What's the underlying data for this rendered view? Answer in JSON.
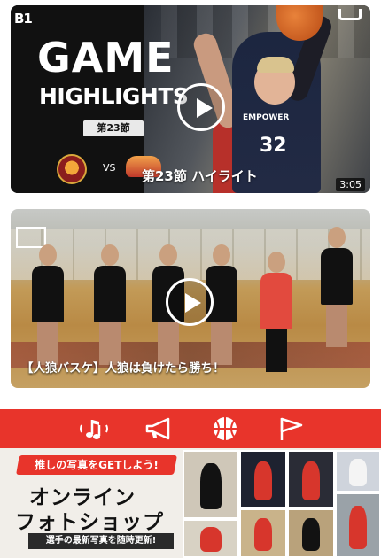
{
  "colors": {
    "brand_red": "#e8342b",
    "card_dark": "#111111",
    "banner_bg": "#f1eee9"
  },
  "video1": {
    "brand": "B1",
    "title_line1": "GAME",
    "title_line2": "HIGHLIGHTS",
    "section_badge": "第23節",
    "vs_label": "VS",
    "jersey_name": "EMPOWER",
    "jersey_number": "32",
    "caption": "第23節 ハイライト",
    "duration": "3:05",
    "play_icon": "play-icon"
  },
  "video2": {
    "caption": "【人狼バスケ】人狼は負けたら勝ち！",
    "play_icon": "play-icon"
  },
  "nav": {
    "items": [
      {
        "icon": "music-note-icon"
      },
      {
        "icon": "megaphone-icon"
      },
      {
        "icon": "basketball-icon"
      },
      {
        "icon": "flag-icon"
      }
    ]
  },
  "banner": {
    "tagline": "推しの写真をGETしよう!",
    "title_line1": "オンライン",
    "title_line2": "フォトショップ",
    "subtitle": "選手の最新写真を随時更新!"
  }
}
